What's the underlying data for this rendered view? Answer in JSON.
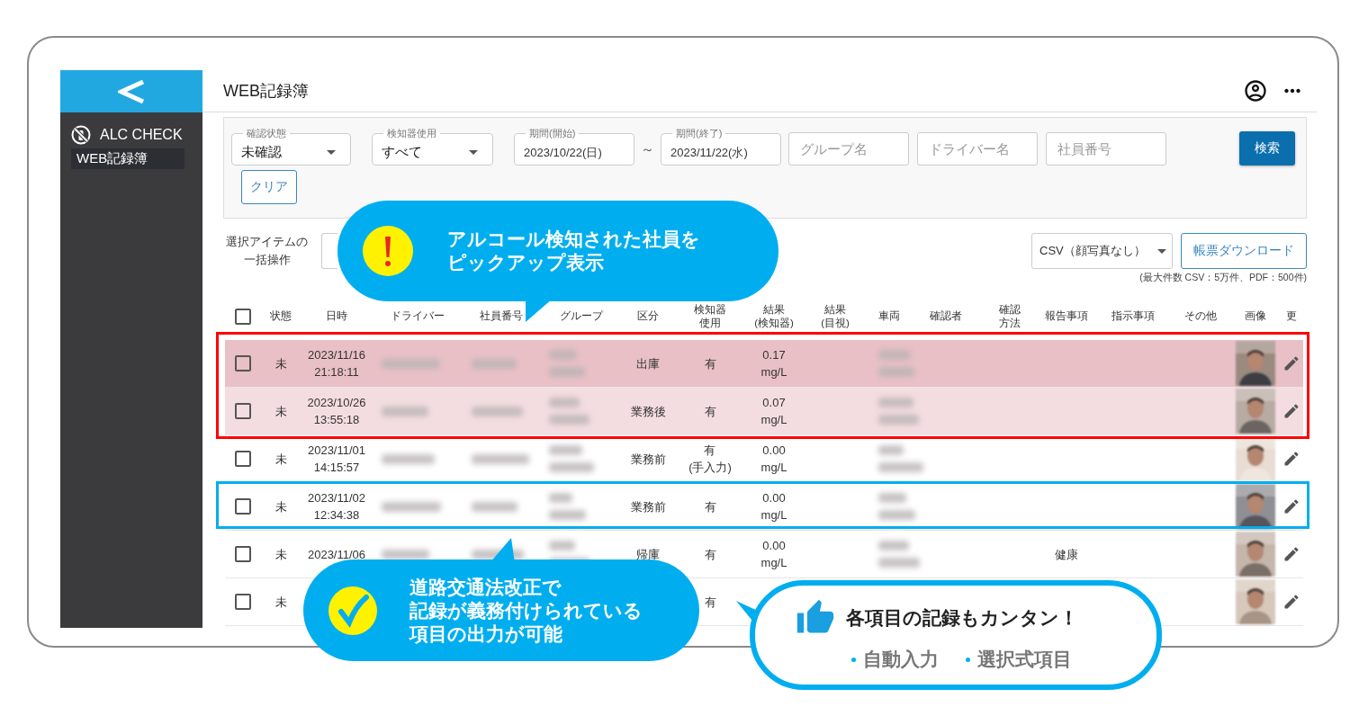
{
  "sidebar": {
    "app_name": "ALC CHECK",
    "items": [
      {
        "label": "WEB記録簿",
        "selected": true
      }
    ]
  },
  "header": {
    "title": "WEB記録簿"
  },
  "filters": {
    "fields": [
      {
        "kind": "select",
        "label": "確認状態",
        "value": "未確認"
      },
      {
        "kind": "select",
        "label": "検知器使用",
        "value": "すべて"
      },
      {
        "kind": "date",
        "label": "期間(開始)",
        "value": "2023/10/22(日)"
      },
      {
        "kind": "separator",
        "text": "～"
      },
      {
        "kind": "date",
        "label": "期間(終了)",
        "value": "2023/11/22(水)"
      },
      {
        "kind": "text",
        "placeholder": "グループ名"
      },
      {
        "kind": "text",
        "placeholder": "ドライバー名"
      },
      {
        "kind": "text",
        "placeholder": "社員番号"
      }
    ],
    "search_button": "検索",
    "clear_button": "クリア"
  },
  "bulk": {
    "lines": [
      "選択アイテムの",
      "一括操作"
    ]
  },
  "export": {
    "format": "CSV（顔写真なし）",
    "download_button": "帳票ダウンロード",
    "note": "(最大件数 CSV：5万件、PDF：500件)"
  },
  "table": {
    "header_checked": false,
    "columns": [
      {
        "kind": "check"
      },
      {
        "kind": "text",
        "label": [
          "状態"
        ]
      },
      {
        "kind": "text",
        "label": [
          "日時"
        ]
      },
      {
        "kind": "masked",
        "label": [
          "ドライバー"
        ]
      },
      {
        "kind": "masked",
        "label": [
          "社員番号"
        ]
      },
      {
        "kind": "masked2",
        "label": [
          "グループ"
        ]
      },
      {
        "kind": "text",
        "label": [
          "区分"
        ]
      },
      {
        "kind": "text",
        "label": [
          "検知器",
          "使用"
        ]
      },
      {
        "kind": "text",
        "label": [
          "結果",
          "(検知器)"
        ]
      },
      {
        "kind": "text",
        "label": [
          "結果",
          "(目視)"
        ]
      },
      {
        "kind": "masked2",
        "label": [
          "車両"
        ]
      },
      {
        "kind": "text",
        "label": [
          "確認者"
        ]
      },
      {
        "kind": "text",
        "label": [
          "確認",
          "方法"
        ]
      },
      {
        "kind": "text",
        "label": [
          "報告事項"
        ]
      },
      {
        "kind": "text",
        "label": [
          "指示事項"
        ]
      },
      {
        "kind": "text",
        "label": [
          "その他"
        ]
      },
      {
        "label": [
          "画像"
        ]
      },
      {
        "kind": "edit",
        "label": [
          "更"
        ]
      }
    ],
    "rows": [
      {
        "checked": false,
        "color": "#e9c0c6",
        "cells": [
          "",
          "未",
          "2023/11/16\n21:18:11",
          "",
          "",
          "",
          "出庫",
          "有",
          "0.17\nmg/L"
        ]
      },
      {
        "checked": false,
        "color": "#f4dde0",
        "cells": [
          "",
          "未",
          "2023/10/26\n13:55:18",
          "",
          "",
          "",
          "業務後",
          "有",
          "0.07\nmg/L"
        ]
      },
      {
        "checked": false,
        "cells": [
          "",
          "未",
          "2023/11/01\n14:15:57",
          "",
          "",
          "",
          "業務前",
          "有\n(手入力)",
          "0.00\nmg/L"
        ]
      },
      {
        "checked": false,
        "cells": [
          "",
          "未",
          "2023/11/02\n12:34:38",
          "",
          "",
          "",
          "業務前",
          "有",
          "0.00\nmg/L"
        ]
      },
      {
        "checked": false,
        "cells": [
          "",
          "未",
          "2023/11/06",
          "",
          "",
          "",
          "帰庫",
          "有",
          "0.00\nmg/L",
          "",
          "",
          "",
          "",
          "健康"
        ]
      },
      {
        "checked": false,
        "cells": [
          "",
          "未",
          "",
          "",
          "",
          "",
          "",
          "有"
        ]
      }
    ]
  },
  "callouts": [
    {
      "kind": "alert",
      "lines": [
        "アルコール検知された社員を",
        "ピックアップ表示"
      ]
    },
    {
      "kind": "check",
      "lines": [
        "道路交通法改正で",
        "記録が義務付けられている",
        "項目の出力が可能"
      ]
    },
    {
      "kind": "tip",
      "title": "各項目の記録もカンタン！",
      "bullets": [
        "自動入力",
        "選択式項目"
      ]
    }
  ]
}
